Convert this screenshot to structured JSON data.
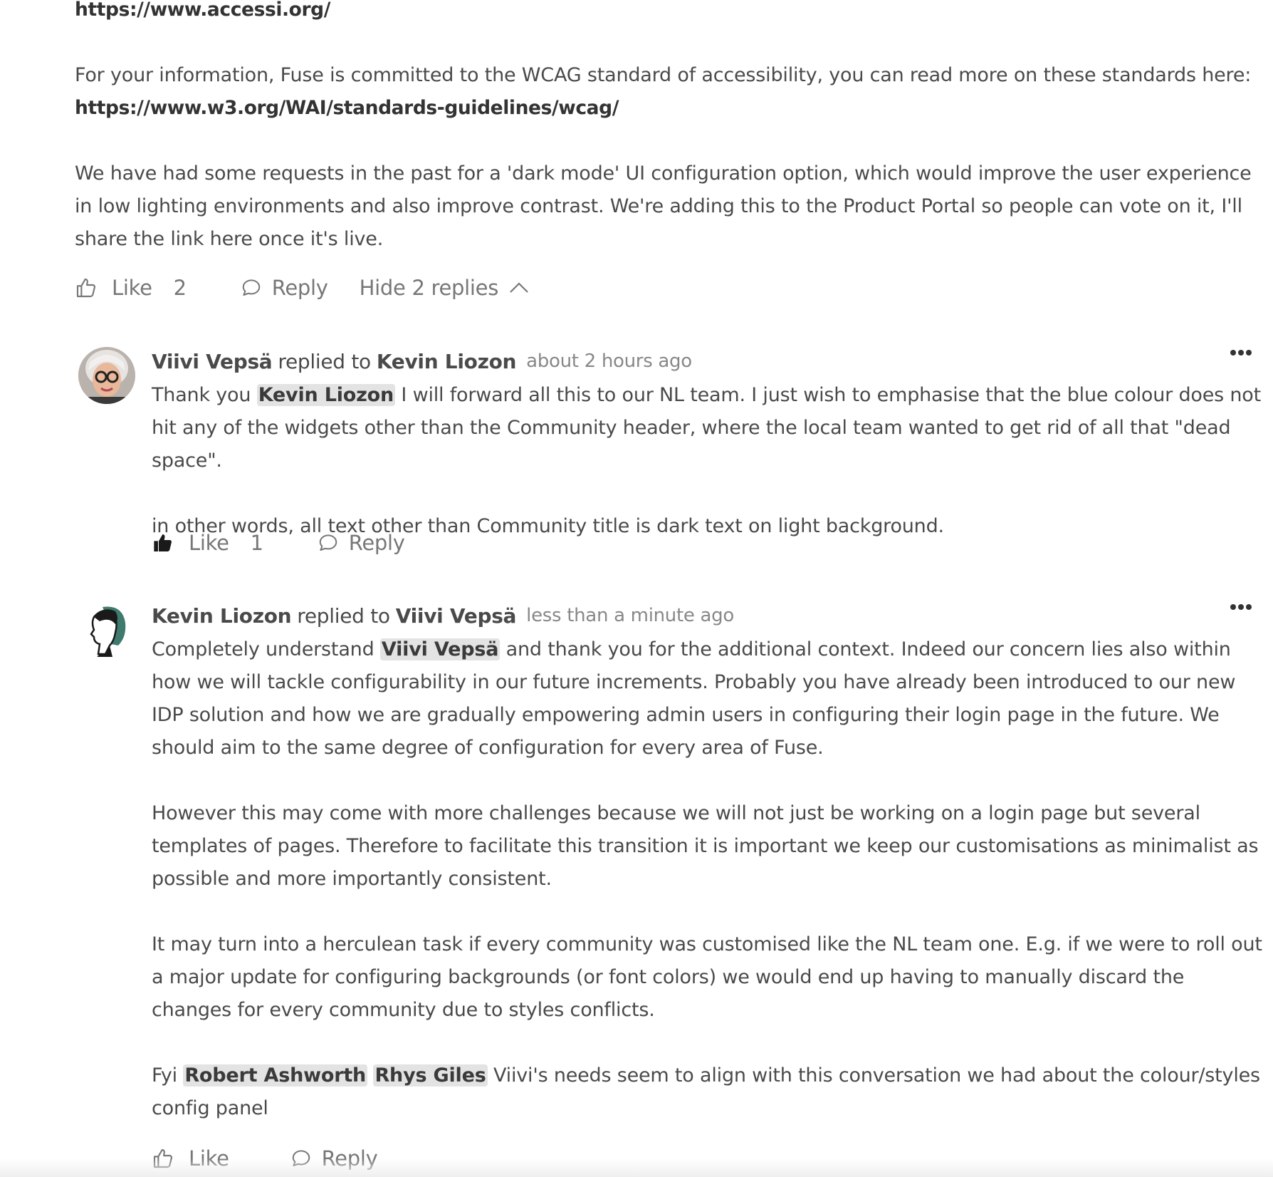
{
  "top": {
    "accessi_link": "https://www.accessi.org/",
    "wcag_para": "For your information, Fuse is committed to the WCAG standard of accessibility, you can read more on these standards here:",
    "wcag_link": "https://www.w3.org/WAI/standards-guidelines/wcag/",
    "darkmode_para": "We have had some requests in the past for a 'dark mode' UI configuration option, which would improve the user experience in low lighting environments and also improve contrast. We're adding this to the Product Portal so people can vote on it, I'll share the link here once it's live.",
    "actions": {
      "like_label": "Like",
      "like_count": "2",
      "reply_label": "Reply",
      "hide_replies_label": "Hide 2 replies"
    }
  },
  "replies": [
    {
      "author": "Viivi Vepsä",
      "replied_to_text": "replied to",
      "target": "Kevin Liozon",
      "time": "about 2 hours ago",
      "p1_before": "Thank you",
      "p1_mention": "Kevin Liozon",
      "p1_after": "I will forward all this to our NL team. I just wish to emphasise that the blue colour does not hit any of the widgets other than the Community header, where the local team wanted to get rid of all that \"dead space\".",
      "p2": "in other words, all text other than Community title is dark text on light background.",
      "like_label": "Like",
      "like_count": "1",
      "liked": true,
      "reply_label": "Reply"
    },
    {
      "author": "Kevin Liozon",
      "replied_to_text": "replied to",
      "target": "Viivi Vepsä",
      "time": "less than a minute ago",
      "p1_before": "Completely understand",
      "p1_mention": "Viivi Vepsä",
      "p1_after": "and thank you for the additional context. Indeed our concern lies also within how we will tackle configurability in our future increments. Probably you have already been introduced to our new IDP solution and how we are gradually empowering admin users in configuring their login page in the future. We should aim to the same degree of configuration for every area of Fuse.",
      "p2": "However this may come with more challenges because we will not just be working on a login page but several templates of pages. Therefore to facilitate this transition it is important we keep our customisations as minimalist as possible and more importantly consistent.",
      "p3": "It may turn into a herculean task if every community was customised like the NL team one. E.g. if we were to roll out a major update for configuring backgrounds (or font colors) we would end up having to manually discard the changes for every community due to styles conflicts.",
      "p4_before": "Fyi",
      "p4_mention1": "Robert Ashworth",
      "p4_mention2": "Rhys Giles",
      "p4_after": "Viivi's needs seem to align with this conversation we had about the colour/styles config panel",
      "like_label": "Like",
      "liked": false,
      "reply_label": "Reply"
    }
  ],
  "icons": {
    "like": "thumbs-up-outline-icon",
    "liked": "thumbs-up-filled-icon",
    "reply": "speech-bubble-icon",
    "chevron": "chevron-up-icon",
    "more": "more-dots-icon"
  }
}
